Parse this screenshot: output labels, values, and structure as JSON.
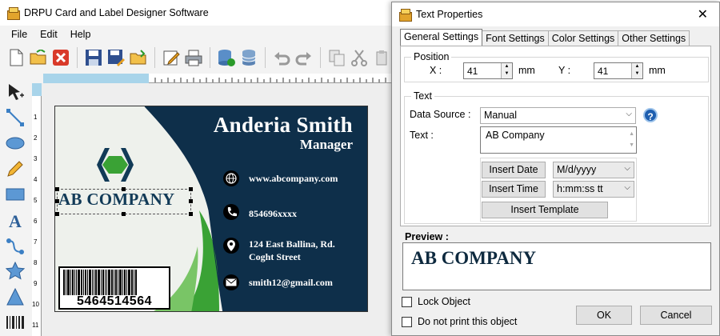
{
  "app": {
    "title": "DRPU Card and Label Designer Software"
  },
  "menu": [
    {
      "label": "File"
    },
    {
      "label": "Edit"
    },
    {
      "label": "Help"
    }
  ],
  "toolbar": {
    "icons": [
      "new-icon",
      "open-icon",
      "close-icon",
      "save-icon",
      "save-as-icon",
      "open-folder-icon",
      "edit-icon",
      "print-icon",
      "database-add-icon",
      "database-icon",
      "undo-icon",
      "redo-icon",
      "copy-icon",
      "cut-icon",
      "paste-icon"
    ]
  },
  "tools": [
    "pointer-icon",
    "line-icon",
    "ellipse-icon",
    "pencil-icon",
    "rectangle-icon",
    "text-tool-icon",
    "curve-icon",
    "star-icon",
    "triangle-icon",
    "barcode-tool-icon"
  ],
  "rulers": {
    "left_marks": [
      "1",
      "2",
      "3",
      "4",
      "5",
      "6",
      "7",
      "8",
      "9",
      "10",
      "11"
    ]
  },
  "card": {
    "name": "Anderia Smith",
    "role": "Manager",
    "company": "AB COMPANY",
    "website": "www.abcompany.com",
    "phone": "854696xxxx",
    "address_line1": "124 East Ballina, Rd.",
    "address_line2": "Coght Street",
    "email": "smith12@gmail.com",
    "barcode": "5464514564"
  },
  "dialog": {
    "title": "Text Properties",
    "close": "✕",
    "tabs": [
      {
        "label": "General Settings"
      },
      {
        "label": "Font Settings"
      },
      {
        "label": "Color Settings"
      },
      {
        "label": "Other Settings"
      }
    ],
    "position": {
      "label": "Position",
      "x_label": "X :",
      "x_value": "41",
      "x_unit": "mm",
      "y_label": "Y :",
      "y_value": "41",
      "y_unit": "mm"
    },
    "text_group": {
      "label": "Text",
      "data_source_label": "Data Source :",
      "data_source_value": "Manual",
      "text_label": "Text :",
      "text_value": "AB Company",
      "insert_date": "Insert Date",
      "date_format": "M/d/yyyy",
      "insert_time": "Insert Time",
      "time_format": "h:mm:ss tt",
      "insert_template": "Insert Template"
    },
    "preview_label": "Preview :",
    "preview_text": "AB COMPANY",
    "lock_object": "Lock Object",
    "do_not_print": "Do not print this object",
    "ok": "OK",
    "cancel": "Cancel"
  },
  "colors": {
    "card_navy": "#0e2f4a",
    "card_green": "#3aa235",
    "accent_blue": "#1f5fb0"
  }
}
